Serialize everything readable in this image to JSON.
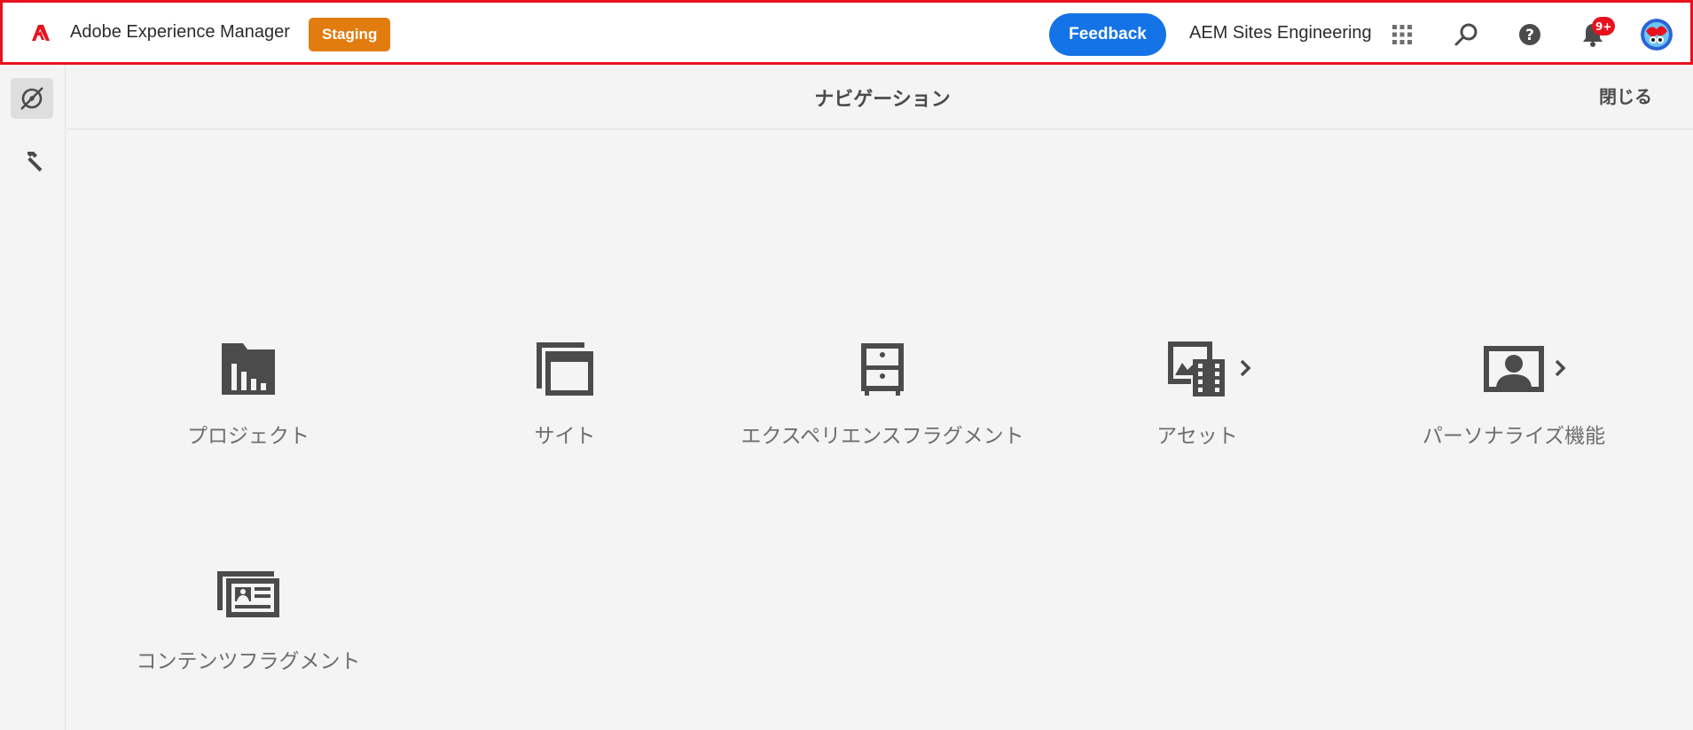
{
  "header": {
    "app_title": "Adobe Experience Manager",
    "env_badge": "Staging",
    "feedback_label": "Feedback",
    "org_name": "AEM Sites Engineering",
    "notification_count": "9+",
    "icons": [
      "adobe-logo",
      "apps-icon",
      "search-icon",
      "help-icon",
      "bell-icon",
      "avatar"
    ]
  },
  "rail": {
    "items": [
      "navigation-icon",
      "tools-icon"
    ]
  },
  "panel": {
    "title": "ナビゲーション",
    "close_label": "閉じる"
  },
  "tiles": [
    {
      "label": "プロジェクト",
      "icon": "projects-icon",
      "has_children": false
    },
    {
      "label": "サイト",
      "icon": "sites-icon",
      "has_children": false
    },
    {
      "label": "エクスペリエンスフラグメント",
      "icon": "experience-fragments-icon",
      "has_children": false
    },
    {
      "label": "アセット",
      "icon": "assets-icon",
      "has_children": true
    },
    {
      "label": "パーソナライズ機能",
      "icon": "personalization-icon",
      "has_children": true
    },
    {
      "label": "コンテンツフラグメント",
      "icon": "content-fragments-icon",
      "has_children": false
    }
  ],
  "colors": {
    "header_border": "#e8121e",
    "staging_badge": "#e37c0f",
    "feedback_button": "#1473e6",
    "icon_gray": "#4b4b4b",
    "label_gray": "#6e6e6e"
  }
}
